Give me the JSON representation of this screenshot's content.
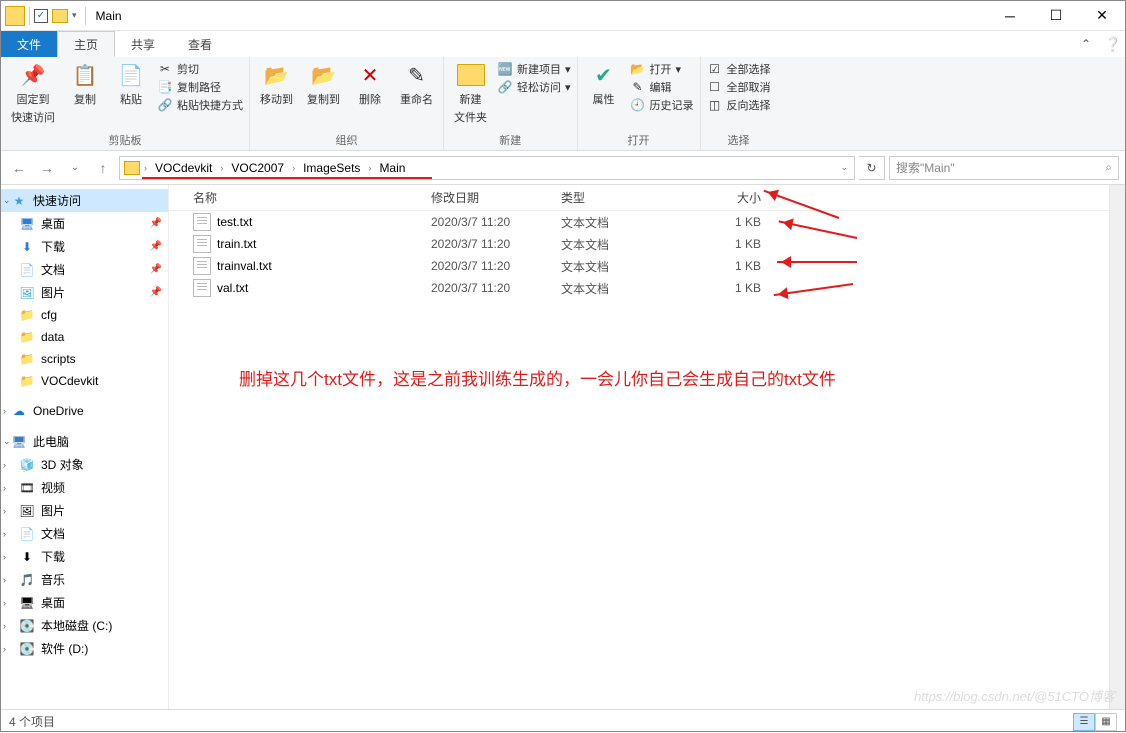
{
  "window": {
    "title": "Main"
  },
  "qat": {
    "check": "✓"
  },
  "tabs": {
    "file": "文件",
    "home": "主页",
    "share": "共享",
    "view": "查看"
  },
  "ribbon": {
    "clipboard": {
      "label": "剪贴板",
      "pin": "固定到快速访问",
      "pin1": "固定到",
      "pin2": "快速访问",
      "copy": "复制",
      "paste": "粘贴",
      "cut": "剪切",
      "copypath": "复制路径",
      "paste_shortcut": "粘贴快捷方式"
    },
    "organize": {
      "label": "组织",
      "moveto": "移动到",
      "copyto": "复制到",
      "delete": "删除",
      "rename": "重命名"
    },
    "new": {
      "label": "新建",
      "newfolder": "新建",
      "newfolder2": "文件夹",
      "newitem": "新建项目",
      "easyaccess": "轻松访问"
    },
    "open": {
      "label": "打开",
      "properties": "属性",
      "open": "打开",
      "edit": "编辑",
      "history": "历史记录"
    },
    "select": {
      "label": "选择",
      "selectall": "全部选择",
      "selectnone": "全部取消",
      "invert": "反向选择"
    }
  },
  "breadcrumb": [
    "VOCdevkit",
    "VOC2007",
    "ImageSets",
    "Main"
  ],
  "nav": {
    "back": "←",
    "fwd": "→",
    "up": "↑",
    "refresh": "↻",
    "dropdown": "⌄"
  },
  "search": {
    "placeholder": "搜索\"Main\"",
    "icon": "⌕"
  },
  "columns": {
    "name": "名称",
    "date": "修改日期",
    "type": "类型",
    "size": "大小"
  },
  "files": [
    {
      "name": "test.txt",
      "date": "2020/3/7 11:20",
      "type": "文本文档",
      "size": "1 KB"
    },
    {
      "name": "train.txt",
      "date": "2020/3/7 11:20",
      "type": "文本文档",
      "size": "1 KB"
    },
    {
      "name": "trainval.txt",
      "date": "2020/3/7 11:20",
      "type": "文本文档",
      "size": "1 KB"
    },
    {
      "name": "val.txt",
      "date": "2020/3/7 11:20",
      "type": "文本文档",
      "size": "1 KB"
    }
  ],
  "annotation": "删掉这几个txt文件，这是之前我训练生成的，一会儿你自己会生成自己的txt文件",
  "navpane": {
    "quick": "快速访问",
    "quick_items": [
      {
        "icon": "🖥",
        "label": "桌面",
        "pin": "📌",
        "color": "#2e7cd6"
      },
      {
        "icon": "⬇",
        "label": "下载",
        "pin": "📌",
        "color": "#2e7cd6"
      },
      {
        "icon": "📄",
        "label": "文档",
        "pin": "📌",
        "color": "#2e7cd6"
      },
      {
        "icon": "🖼",
        "label": "图片",
        "pin": "📌",
        "color": "#39a5dd"
      },
      {
        "icon": "📁",
        "label": "cfg",
        "pin": "",
        "color": "#ffd96a"
      },
      {
        "icon": "📁",
        "label": "data",
        "pin": "",
        "color": "#ffd96a"
      },
      {
        "icon": "📁",
        "label": "scripts",
        "pin": "",
        "color": "#ffd96a"
      },
      {
        "icon": "📁",
        "label": "VOCdevkit",
        "pin": "",
        "color": "#ffd96a"
      }
    ],
    "onedrive": "OneDrive",
    "thispc": "此电脑",
    "pc_items": [
      {
        "icon": "🧊",
        "label": "3D 对象"
      },
      {
        "icon": "🎞",
        "label": "视频"
      },
      {
        "icon": "🖼",
        "label": "图片"
      },
      {
        "icon": "📄",
        "label": "文档"
      },
      {
        "icon": "⬇",
        "label": "下载"
      },
      {
        "icon": "🎵",
        "label": "音乐"
      },
      {
        "icon": "🖥",
        "label": "桌面"
      },
      {
        "icon": "💽",
        "label": "本地磁盘 (C:)"
      },
      {
        "icon": "💽",
        "label": "软件 (D:)"
      }
    ]
  },
  "status": {
    "items": "4 个项目"
  },
  "watermark": "https://blog.csdn.net/@51CTO博客"
}
